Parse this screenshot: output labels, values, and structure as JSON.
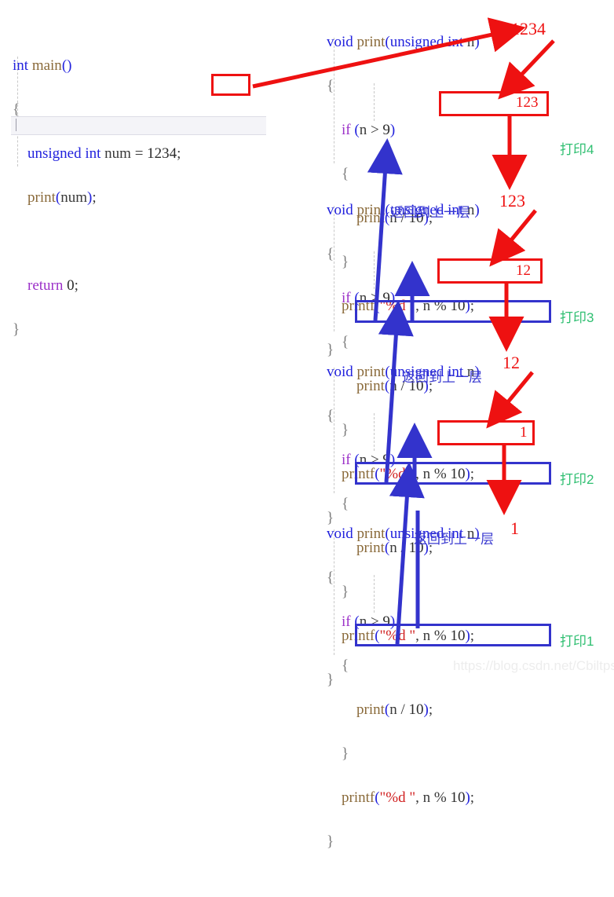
{
  "watermark": "https://blog.csdn.net/Cbiltps",
  "main_block": {
    "lines": [
      "int main()",
      "{",
      "    unsigned int num = 1234;",
      "    print(num);",
      "",
      "    return 0;",
      "}"
    ],
    "highlighted_value": "1234"
  },
  "frames": [
    {
      "signature": "void print(unsigned int n)",
      "open_brace": "{",
      "if_line": "if (n > 9)",
      "if_open": "{",
      "call_line": "print(n / 10);",
      "if_close": "}",
      "printf_line": "printf(\"%d \", n % 10);",
      "close_brace": "}",
      "arg_value": "1234",
      "passed_value": "123",
      "print_label": "打印4",
      "return_label": "",
      "call_boxed": true,
      "printf_boxed": false
    },
    {
      "signature": "void print(unsigned int n)",
      "open_brace": "{",
      "if_line": "if (n > 9)",
      "if_open": "{",
      "call_line": "print(n / 10);",
      "if_close": "}",
      "printf_line": "printf(\"%d \", n % 10);",
      "close_brace": "}",
      "arg_value": "123",
      "passed_value": "12",
      "print_label": "打印3",
      "return_label": "返回到上一层",
      "call_boxed": true,
      "printf_boxed": true
    },
    {
      "signature": "void print(unsigned int n)",
      "open_brace": "{",
      "if_line": "if (n > 9)",
      "if_open": "{",
      "call_line": "print(n / 10);",
      "if_close": "}",
      "printf_line": "printf(\"%d \", n % 10);",
      "close_brace": "}",
      "arg_value": "12",
      "passed_value": "1",
      "print_label": "打印2",
      "return_label": "返回到上一层",
      "call_boxed": true,
      "printf_boxed": true
    },
    {
      "signature": "void print(unsigned int n)",
      "open_brace": "{",
      "if_line": "if (n > 9)",
      "if_open": "{",
      "call_line": "print(n / 10);",
      "if_close": "}",
      "printf_line": "printf(\"%d \", n % 10);",
      "close_brace": "}",
      "arg_value": "1",
      "passed_value": "",
      "print_label": "打印1",
      "return_label": "返回到上一层",
      "call_boxed": false,
      "printf_boxed": true
    }
  ],
  "colors": {
    "red": "#ee1111",
    "blue": "#3333cc",
    "green": "#2fbf71",
    "keyword": "#2222dd",
    "control": "#9b30c8",
    "function": "#8a6a3a",
    "string": "#d02020"
  }
}
